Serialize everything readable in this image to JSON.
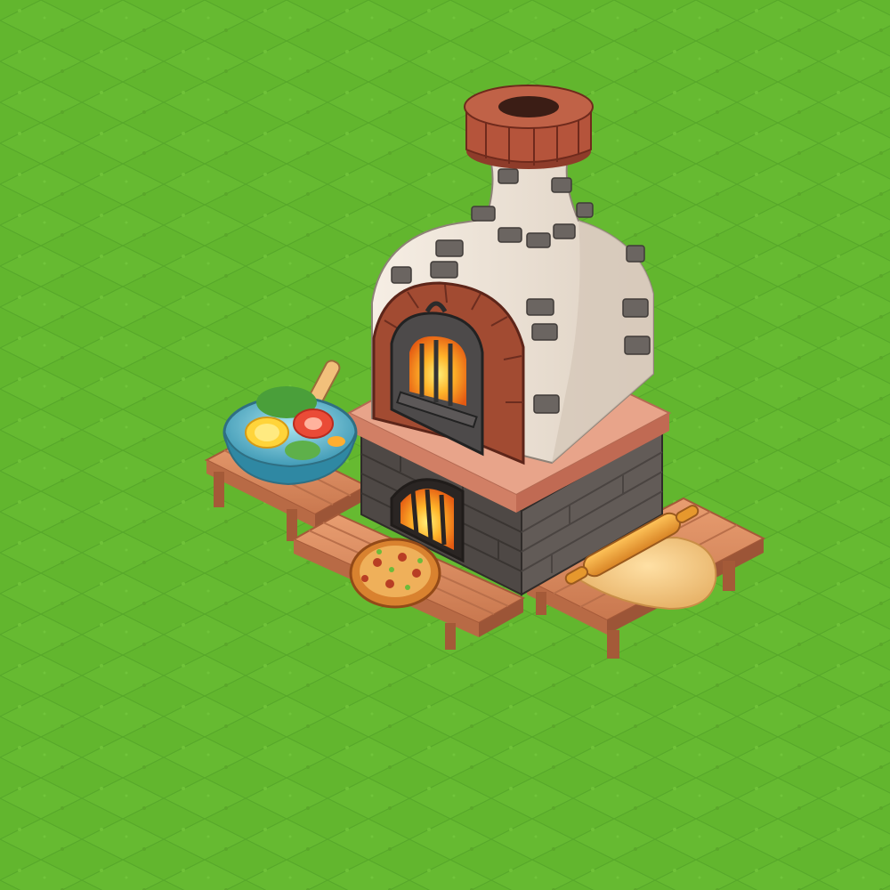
{
  "scene": {
    "ground": "grass-tile-field",
    "building": "pizza-oven",
    "props": [
      "salad-bowl",
      "pizza",
      "rolling-pin",
      "dough"
    ]
  },
  "colors": {
    "grass": "#62b62e",
    "grass_dark": "#55a127",
    "grass_light": "#73c63a",
    "wood": "#d98a5d",
    "wood_dark": "#b86a45",
    "brick": "#a64a32",
    "stone_dark": "#5e5957",
    "plaster": "#efe6da",
    "fire": "#ff9a1e"
  },
  "icons": [
    "chimney",
    "oven-door",
    "fire",
    "salad-bowl",
    "pizza",
    "rolling-pin",
    "dough"
  ]
}
